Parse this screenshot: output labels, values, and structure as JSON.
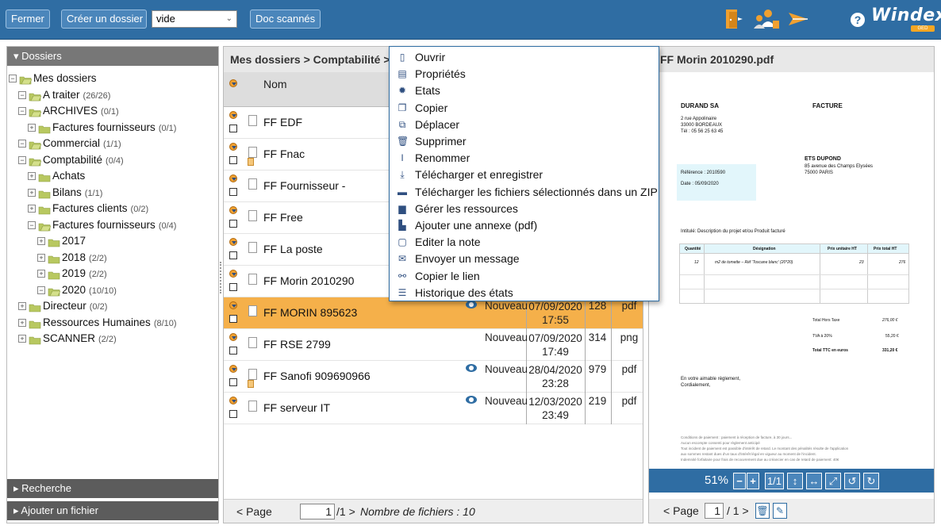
{
  "toolbar": {
    "close_label": "Fermer",
    "create_folder_label": "Créer un dossier",
    "folder_type_select": "vide",
    "scanned_docs_label": "Doc scannés",
    "help_label": "?",
    "logo_text": "Windex",
    "logo_sub": "GED",
    "icons": [
      "exit-door-icon",
      "users-icon",
      "send-icon"
    ]
  },
  "left_panel": {
    "header": "▾ Dossiers",
    "tree": [
      {
        "label": "Mes dossiers",
        "count": "",
        "level": 0,
        "toggle": "−"
      },
      {
        "label": "A traiter",
        "count": "(26/26)",
        "level": 1,
        "toggle": "−"
      },
      {
        "label": "ARCHIVES",
        "count": "(0/1)",
        "level": 1,
        "toggle": "−"
      },
      {
        "label": "Factures fournisseurs",
        "count": "(0/1)",
        "level": 2,
        "toggle": "+"
      },
      {
        "label": "Commercial",
        "count": "(1/1)",
        "level": 1,
        "toggle": "−"
      },
      {
        "label": "Comptabilité",
        "count": "(0/4)",
        "level": 1,
        "toggle": "−"
      },
      {
        "label": "Achats",
        "count": "",
        "level": 2,
        "toggle": "+"
      },
      {
        "label": "Bilans",
        "count": "(1/1)",
        "level": 2,
        "toggle": "+"
      },
      {
        "label": "Factures clients",
        "count": "(0/2)",
        "level": 2,
        "toggle": "+"
      },
      {
        "label": "Factures fournisseurs",
        "count": "(0/4)",
        "level": 2,
        "toggle": "−"
      },
      {
        "label": "2017",
        "count": "",
        "level": 3,
        "toggle": "+"
      },
      {
        "label": "2018",
        "count": "(2/2)",
        "level": 3,
        "toggle": "+"
      },
      {
        "label": "2019",
        "count": "(2/2)",
        "level": 3,
        "toggle": "+"
      },
      {
        "label": "2020",
        "count": "(10/10)",
        "level": 3,
        "toggle": "−"
      },
      {
        "label": "Directeur",
        "count": "(0/2)",
        "level": 1,
        "toggle": "+"
      },
      {
        "label": "Ressources Humaines",
        "count": "(8/10)",
        "level": 1,
        "toggle": "+"
      },
      {
        "label": "SCANNER",
        "count": "(2/2)",
        "level": 1,
        "toggle": "+"
      }
    ],
    "search_label": "▸ Recherche",
    "add_file_label": "▸ Ajouter un fichier"
  },
  "middle_panel": {
    "breadcrumb": "Mes dossiers > Comptabilité > F",
    "column_name": "Nom",
    "rows": [
      {
        "name": "FF EDF",
        "status": "",
        "date": "",
        "time": "",
        "size": "",
        "ext": "",
        "eye": false,
        "selected": false,
        "attach": false
      },
      {
        "name": "FF Fnac",
        "status": "",
        "date": "",
        "time": "",
        "size": "",
        "ext": "",
        "eye": false,
        "selected": false,
        "attach": true
      },
      {
        "name": "FF Fournisseur -",
        "status": "",
        "date": "",
        "time": "",
        "size": "",
        "ext": "",
        "eye": false,
        "selected": false,
        "attach": false
      },
      {
        "name": "FF Free",
        "status": "",
        "date": "",
        "time": "",
        "size": "",
        "ext": "",
        "eye": false,
        "selected": false,
        "attach": false
      },
      {
        "name": "FF La poste",
        "status": "",
        "date": "",
        "time": "",
        "size": "",
        "ext": "",
        "eye": false,
        "selected": false,
        "attach": false
      },
      {
        "name": "FF Morin 2010290",
        "status": "",
        "date": "",
        "time": "",
        "size": "",
        "ext": "",
        "eye": false,
        "selected": false,
        "attach": false
      },
      {
        "name": "FF MORIN 895623",
        "status": "Nouveau",
        "date": "07/09/2020",
        "time": "17:55",
        "size": "128",
        "ext": "pdf",
        "eye": true,
        "selected": true,
        "attach": false
      },
      {
        "name": "FF RSE 2799",
        "status": "Nouveau",
        "date": "07/09/2020",
        "time": "17:49",
        "size": "314",
        "ext": "png",
        "eye": false,
        "selected": false,
        "attach": false
      },
      {
        "name": "FF Sanofi 909690966",
        "status": "Nouveau",
        "date": "28/04/2020",
        "time": "23:28",
        "size": "979",
        "ext": "pdf",
        "eye": true,
        "selected": false,
        "attach": true
      },
      {
        "name": "FF serveur IT",
        "status": "Nouveau",
        "date": "12/03/2020",
        "time": "23:49",
        "size": "219",
        "ext": "pdf",
        "eye": true,
        "selected": false,
        "attach": false
      }
    ],
    "footer": {
      "page_label": "< Page",
      "page_value": "1",
      "page_total": "/1 >",
      "file_count_label": "Nombre de fichiers : 10"
    }
  },
  "context_menu": {
    "items": [
      {
        "label": "Ouvrir",
        "icon": "page-icon",
        "glyph": "▯"
      },
      {
        "label": "Propriétés",
        "icon": "properties-icon",
        "glyph": "▤"
      },
      {
        "label": "Etats",
        "icon": "states-icon",
        "glyph": "✹"
      },
      {
        "label": "Copier",
        "icon": "copy-icon",
        "glyph": "❐"
      },
      {
        "label": "Déplacer",
        "icon": "move-icon",
        "glyph": "⧉"
      },
      {
        "label": "Supprimer",
        "icon": "trash-icon",
        "glyph": "🗑"
      },
      {
        "label": "Renommer",
        "icon": "rename-icon",
        "glyph": "I"
      },
      {
        "label": "Télécharger et enregistrer",
        "icon": "download-icon",
        "glyph": "⤓"
      },
      {
        "label": "Télécharger les fichiers sélectionnés dans un ZIP",
        "icon": "zip-icon",
        "glyph": "▬"
      },
      {
        "label": "Gérer les ressources",
        "icon": "resources-icon",
        "glyph": "▆"
      },
      {
        "label": "Ajouter une annexe (pdf)",
        "icon": "attach-pdf-icon",
        "glyph": "▙"
      },
      {
        "label": "Editer la note",
        "icon": "note-icon",
        "glyph": "▢"
      },
      {
        "label": "Envoyer un message",
        "icon": "mail-icon",
        "glyph": "✉"
      },
      {
        "label": "Copier le lien",
        "icon": "link-icon",
        "glyph": "⚯"
      },
      {
        "label": "Historique des états",
        "icon": "history-icon",
        "glyph": "☰"
      }
    ]
  },
  "right_panel": {
    "title": "FF Morin 2010290.pdf",
    "zoom": "51%",
    "tools": [
      "1/1",
      "↕",
      "↔",
      "⤢",
      "↺",
      "↻"
    ],
    "footer": {
      "page_label": "< Page",
      "page_value": "1",
      "page_total": "/ 1 >"
    },
    "pdf": {
      "company": "DURAND SA",
      "doc_type": "FACTURE",
      "addr1": "2 rue Appolinaire",
      "addr2": "33000 BORDEAUX",
      "tel": "Tél : 05 56 25 63 45",
      "client": "ETS DUPOND",
      "client_addr1": "85 avenue des Champs Elysées",
      "client_addr2": "75000 PARIS",
      "reference": "Référence : 2010590",
      "date": "Date       : 05/09/2020",
      "intitule": "Intitulé: Description du projet et/ou Produit facturé",
      "table_head": [
        "Quantité",
        "Désignation",
        "Prix unitaire HT",
        "Prix total HT"
      ],
      "table_row": [
        "12",
        "m2 de tomette – Réf 'Toscane blanc' (20*20)",
        "23",
        "276"
      ],
      "total_ht_label": "Total Hors Taxe",
      "total_ht": "276,00 €",
      "tva_label": "TVA à 20%",
      "tva": "55,20 €",
      "ttc_label": "Total TTC en euros",
      "ttc": "331,20 €",
      "closing1": "En votre aimable règlement,",
      "closing2": "Cordialement,",
      "cond1": "Conditions de paiement : paiement à réception de facture, à 30 jours...",
      "cond2": "Aucun escompte consenti pour règlement anticipé",
      "cond3": "Tout incident de paiement est passible d'intérêt de retard. Le montant des pénalités résulte de l'application",
      "cond4": "aux sommes restant dues d'un taux d'intérêt légal en vigueur au moment de l'incident.",
      "cond5": "Indemnité forfaitaire pour frais de recouvrement due au créancier en cas de retard de paiement: 40€"
    }
  },
  "colors": {
    "accent": "#2f6da3",
    "selected_row": "#f5b04a",
    "folder": "#b8c860"
  }
}
